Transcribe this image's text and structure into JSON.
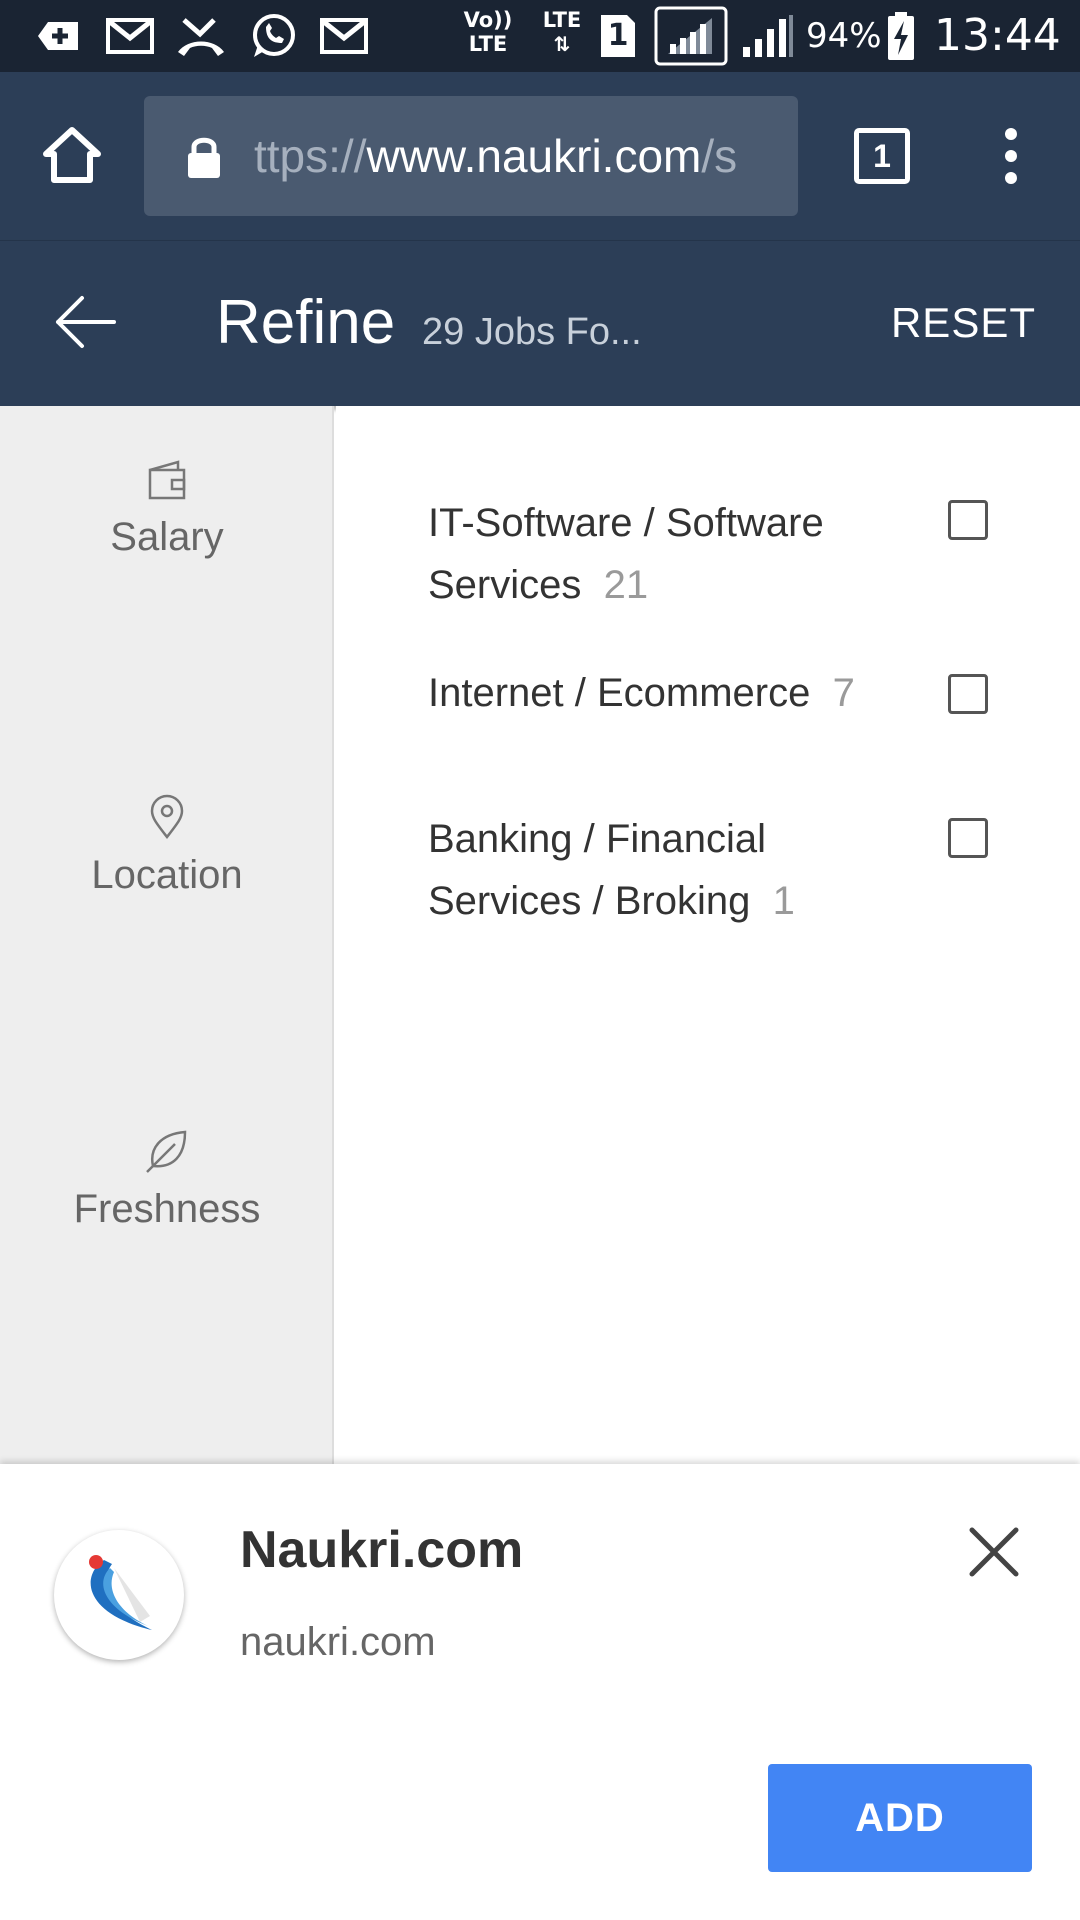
{
  "status_bar": {
    "volte_line1": "Vo))",
    "volte_line2": "LTE",
    "lte_label": "LTE",
    "sim_slot": "1",
    "battery_percent": "94%",
    "time": "13:44",
    "icons": [
      "add-notification-icon",
      "gmail-icon",
      "missed-call-icon",
      "whatsapp-icon",
      "gmail-icon",
      "signal-icon",
      "battery-charging-icon"
    ]
  },
  "browser": {
    "url_scheme": "ttps://",
    "url_host": "www.naukri.com",
    "url_rest": "/s",
    "tab_count": "1",
    "icons": [
      "home-icon",
      "lock-icon",
      "tabs-icon",
      "more-menu-icon"
    ]
  },
  "header": {
    "title": "Refine",
    "subtitle": "29 Jobs Fo...",
    "reset_label": "RESET",
    "icons": [
      "back-arrow-icon"
    ]
  },
  "sidebar": {
    "items": [
      {
        "label": "Salary",
        "icon": "wallet-icon"
      },
      {
        "label": "Location",
        "icon": "location-pin-icon"
      },
      {
        "label": "Freshness",
        "icon": "leaf-icon"
      }
    ]
  },
  "options": [
    {
      "label": "IT-Software / Software Services",
      "count": "21",
      "checked": false
    },
    {
      "label": "Internet / Ecommerce",
      "count": "7",
      "checked": false
    },
    {
      "label": "Banking / Financial Services / Broking",
      "count": "1",
      "checked": false
    }
  ],
  "install_sheet": {
    "app_name": "Naukri.com",
    "domain": "naukri.com",
    "add_label": "ADD",
    "icons": [
      "naukri-logo-icon",
      "close-icon"
    ]
  },
  "colors": {
    "status_bar": "#1a2433",
    "header": "#2c3e57",
    "url_box": "#4a5a70",
    "sidebar": "#eeeeee",
    "add_button": "#4285f4"
  }
}
